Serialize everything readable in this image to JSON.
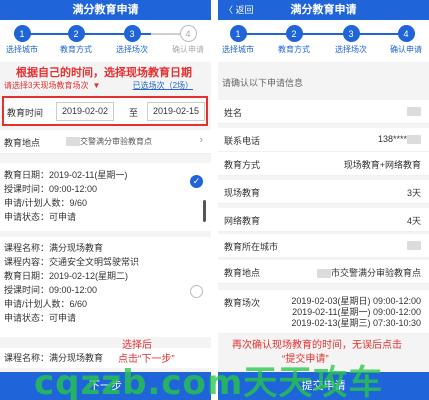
{
  "left": {
    "title": "满分教育申请",
    "steps": [
      {
        "num": "1",
        "label": "选择城市",
        "done": true
      },
      {
        "num": "2",
        "label": "教育方式",
        "done": true
      },
      {
        "num": "3",
        "label": "选择场次",
        "done": true
      },
      {
        "num": "4",
        "label": "确认申请",
        "done": false
      }
    ],
    "annotation_top": "根据自己的时间，选择现场教育日期",
    "subhint": "请选择3天现场教育场次",
    "selected_link": "已选场次（2场）",
    "date_label": "教育时间",
    "date_from": "2019-02-02",
    "date_to_sep": "至",
    "date_to": "2019-02-15",
    "location_label": "教育地点",
    "location_value": "交警满分审验教育点",
    "card1": [
      "教育日期：2019-02-11(星期一)",
      "授课时间：09:00-12:00",
      "申请/计划人数：9/60",
      "申请状态：可申请"
    ],
    "card2": [
      "课程名称：满分现场教育",
      "课程内容：交通安全文明驾驶常识",
      "教育日期：2019-02-12(星期二)",
      "授课时间：09:00-12:00",
      "申请/计划人数：6/60",
      "申请状态：可申请"
    ],
    "card3_first": "课程名称：满分现场教育",
    "annotation_bottom_1": "选择后",
    "annotation_bottom_2": "点击“下一步”",
    "next_button": "下一步"
  },
  "right": {
    "back": "〈 返回",
    "title": "满分教育申请",
    "steps": [
      {
        "num": "1",
        "label": "选择城市"
      },
      {
        "num": "2",
        "label": "教育方式"
      },
      {
        "num": "3",
        "label": "选择场次"
      },
      {
        "num": "4",
        "label": "确认申请"
      }
    ],
    "info_head": "请确认以下申请信息",
    "fields": {
      "name_k": "姓名",
      "phone_k": "联系电话",
      "phone_v": "138****",
      "mode_k": "教育方式",
      "mode_v": "现场教育+网络教育",
      "onsite_k": "现场教育",
      "onsite_v": "3天",
      "online_k": "网络教育",
      "online_v": "4天",
      "city_k": "教育所在城市",
      "place_k": "教育地点",
      "place_v": "市交警满分审验教育点",
      "session_k": "教育场次"
    },
    "sessions": [
      "2019-02-03(星期日) 09:00-12:00",
      "2019-02-11(星期一) 09:00-12:00",
      "2019-02-13(星期三) 07:30-10:30"
    ],
    "annotation_1": "再次确认现场教育的时间，无误后点击",
    "annotation_2": "“提交申请”",
    "submit_button": "提交申请"
  },
  "watermark": "cqzzb.com天天攻车"
}
